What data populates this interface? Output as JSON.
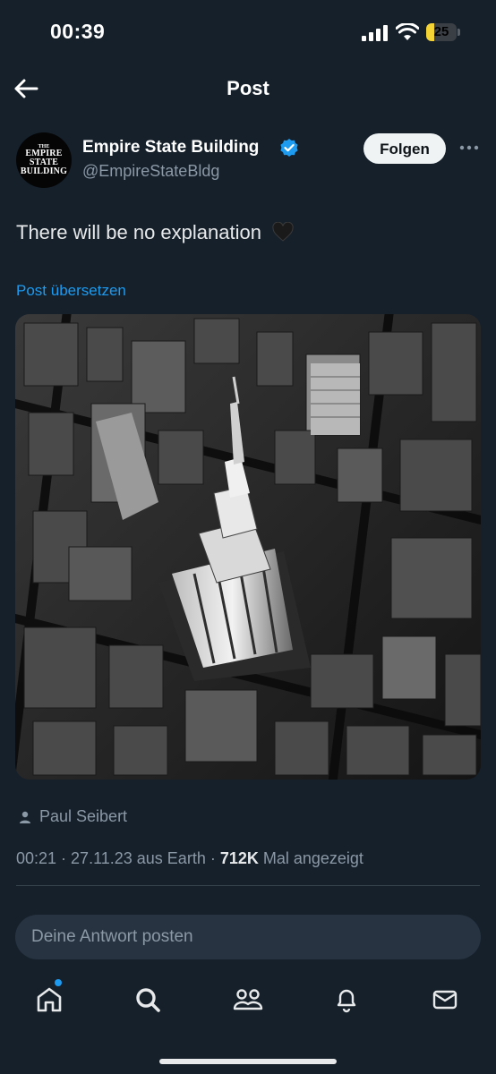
{
  "status_bar": {
    "time": "00:39",
    "battery": "25",
    "battery_level": 0.25
  },
  "header": {
    "title": "Post",
    "back_icon": "arrow-left-icon"
  },
  "author": {
    "name": "Empire State Building",
    "handle": "@EmpireStateBldg",
    "verified": true,
    "avatar_text": [
      "THE",
      "EMPIRE",
      "STATE",
      "BUILDING"
    ]
  },
  "follow_label": "Folgen",
  "post": {
    "text": "There will be no explanation",
    "emoji": "black-heart",
    "translate_label": "Post übersetzen",
    "image_alt": "Aerial black-and-white view of the Empire State Building spire",
    "photo_credit": "Paul Seibert",
    "meta_time": "00:21",
    "meta_sep1": " · ",
    "meta_date": "27.11.23",
    "meta_source": " aus Earth · ",
    "views": "712K",
    "views_label": " Mal angezeigt"
  },
  "reply": {
    "placeholder": "Deine Antwort posten"
  },
  "nav": [
    {
      "icon": "home-icon",
      "active": true
    },
    {
      "icon": "search-icon"
    },
    {
      "icon": "communities-icon"
    },
    {
      "icon": "bell-icon"
    },
    {
      "icon": "mail-icon"
    }
  ],
  "colors": {
    "background": "#15202b",
    "accent": "#1d9bf0",
    "text": "#e7e9ea",
    "secondary": "#8b98a5"
  }
}
